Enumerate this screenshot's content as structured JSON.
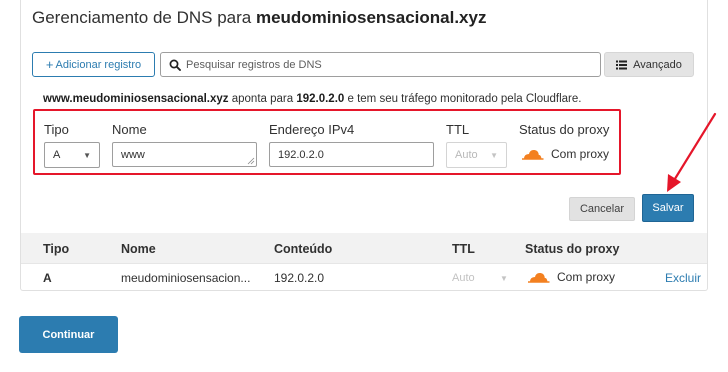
{
  "header": {
    "title_prefix": "Gerenciamento de DNS para ",
    "title_domain": "meudominiosensacional.xyz"
  },
  "toolbar": {
    "add_label": "Adicionar registro",
    "search_placeholder": "Pesquisar registros de DNS",
    "advanced_label": "Avançado"
  },
  "info": {
    "domain": "www.meudominiosensacional.xyz",
    "text1": " aponta para ",
    "ip": "192.0.2.0",
    "text2": " e tem seu tráfego monitorado pela Cloudflare."
  },
  "form": {
    "labels": {
      "type": "Tipo",
      "name": "Nome",
      "ipv4": "Endereço IPv4",
      "ttl": "TTL",
      "proxy": "Status do proxy"
    },
    "type_value": "A",
    "name_value": "www",
    "ipv4_value": "192.0.2.0",
    "ttl_value": "Auto",
    "proxy_value": "Com proxy",
    "cancel_label": "Cancelar",
    "save_label": "Salvar"
  },
  "table": {
    "columns": [
      "Tipo",
      "Nome",
      "Conteúdo",
      "TTL",
      "Status do proxy"
    ],
    "rows": [
      {
        "type": "A",
        "name": "meudominiosensacion...",
        "content": "192.0.2.0",
        "ttl": "Auto",
        "proxy": "Com proxy",
        "action": "Excluir"
      }
    ]
  },
  "footer": {
    "continue_label": "Continuar"
  },
  "colors": {
    "accent": "#2c7cb0",
    "highlight": "#e5162a",
    "cloud": "#f38020"
  },
  "icons": [
    "plus-icon",
    "search-icon",
    "filter-list-icon",
    "chevron-down-icon",
    "cloud-proxy-icon",
    "annotation-arrow-icon"
  ]
}
